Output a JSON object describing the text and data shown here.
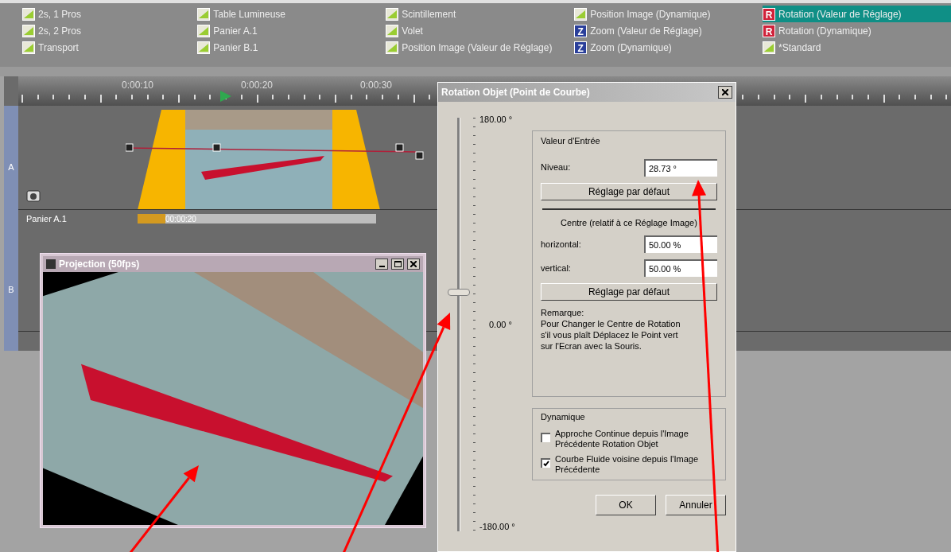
{
  "effects": [
    [
      {
        "label": "2s, 1 Pros",
        "selected": false
      },
      {
        "label": "2s, 2 Pros",
        "selected": false
      },
      {
        "label": "Transport",
        "selected": false
      }
    ],
    [
      {
        "label": "Table Lumineuse",
        "selected": false
      },
      {
        "label": "Panier A.1",
        "selected": false
      },
      {
        "label": "Panier B.1",
        "selected": false
      }
    ],
    [
      {
        "label": "Scintillement",
        "selected": false
      },
      {
        "label": "Volet",
        "selected": false
      },
      {
        "label": "Position Image (Valeur de Réglage)",
        "selected": false
      }
    ],
    [
      {
        "label": "Position Image (Dynamique)",
        "selected": false
      },
      {
        "label": "Zoom (Valeur de Réglage)",
        "selected": false,
        "badge": "Z",
        "color": "#2a3f9a"
      },
      {
        "label": "Zoom (Dynamique)",
        "selected": false,
        "badge": "Z",
        "color": "#2a3f9a"
      }
    ],
    [
      {
        "label": "Rotation (Valeur de Réglage)",
        "selected": true,
        "badge": "R",
        "color": "#d0223a"
      },
      {
        "label": "Rotation (Dynamique)",
        "selected": false,
        "badge": "R",
        "color": "#d0223a"
      },
      {
        "label": "*Standard",
        "selected": false
      }
    ]
  ],
  "timeline": {
    "ruler": [
      "0:00:10",
      "0:00:20",
      "0:00:30"
    ],
    "tracks": [
      {
        "letter": "A",
        "name": "Panier A.1",
        "clip_time": "00:00:20"
      },
      {
        "letter": "B"
      }
    ]
  },
  "projection": {
    "title": "Projection (50fps)"
  },
  "dialog": {
    "title": "Rotation Objet (Point de Courbe)",
    "slider": {
      "max": "180.00 °",
      "mid": "0.00 °",
      "min": "-180.00 °",
      "level": 0.58
    },
    "input_group": {
      "title": "Valeur d'Entrée",
      "level_label": "Niveau:",
      "level_value": "28.73 °",
      "default_button": "Réglage par défaut",
      "centre_title": "Centre (relatif à ce Réglage Image)",
      "horizontal_label": "horizontal:",
      "horizontal_value": "50.00 %",
      "vertical_label": "vertical:",
      "vertical_value": "50.00 %",
      "default_button_2": "Réglage par défaut",
      "note": "Remarque:\nPour Changer le Centre de Rotation s'il vous plaît Déplacez le Point vert sur l'Ecran avec la Souris."
    },
    "dynamic_group": {
      "title": "Dynamique",
      "options": [
        {
          "label": "Approche Continue depuis l'Image Précédente Rotation Objet",
          "checked": false
        },
        {
          "label": "Courbe Fluide voisine depuis l'Image Précédente",
          "checked": true
        }
      ]
    },
    "buttons": [
      "OK",
      "Annuler"
    ]
  }
}
